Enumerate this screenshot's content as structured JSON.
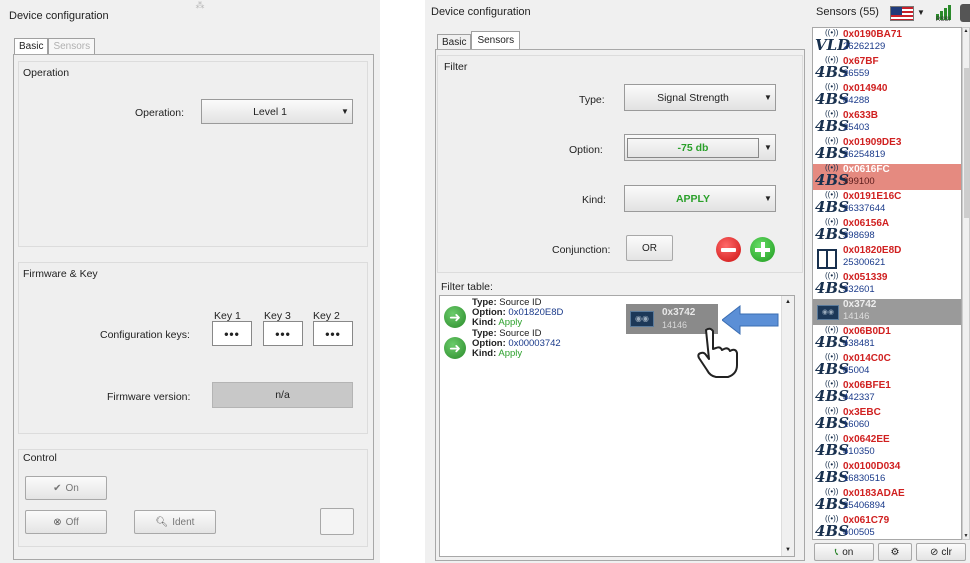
{
  "left": {
    "title": "Device configuration",
    "tabs": [
      "Basic",
      "Sensors"
    ],
    "operation_group": "Operation",
    "operation_label": "Operation:",
    "operation_value": "Level 1",
    "firmware_group": "Firmware & Key",
    "keys": [
      {
        "name": "Key 1",
        "value": "•••"
      },
      {
        "name": "Key 3",
        "value": "•••"
      },
      {
        "name": "Key 2",
        "value": "•••"
      }
    ],
    "config_keys_label": "Configuration keys:",
    "firmware_label": "Firmware version:",
    "firmware_value": "n/a",
    "control_group": "Control",
    "on_label": "On",
    "off_label": "Off",
    "ident_label": "Ident"
  },
  "right": {
    "title": "Device configuration",
    "tabs": [
      "Basic",
      "Sensors"
    ],
    "filter_group": "Filter",
    "type_label": "Type:",
    "type_value": "Signal Strength",
    "option_label": "Option:",
    "option_value": "-75 db",
    "kind_label": "Kind:",
    "kind_value": "APPLY",
    "conj_label": "Conjunction:",
    "conj_value": "OR",
    "filter_table_label": "Filter table:",
    "filter_rows": [
      {
        "type_key": "Type:",
        "type_val": "Source ID",
        "opt_key": "Option:",
        "opt_val": "0x01820E8D",
        "kind_key": "Kind:",
        "kind_val": "Apply"
      },
      {
        "type_key": "Type:",
        "type_val": "Source ID",
        "opt_key": "Option:",
        "opt_val": "0x00003742",
        "kind_key": "Kind:",
        "kind_val": "Apply"
      }
    ],
    "drag_hex": "0x3742",
    "drag_dec": "14146"
  },
  "sensors": {
    "title": "Sensors (55)",
    "rssi_label": "RSSI",
    "items": [
      {
        "icon": "VLD",
        "hex": "0x0190BA71",
        "dec": "26262129"
      },
      {
        "icon": "4BS",
        "hex": "0x67BF",
        "dec": "26559"
      },
      {
        "icon": "4BS",
        "hex": "0x014940",
        "dec": "84288"
      },
      {
        "icon": "4BS",
        "hex": "0x633B",
        "dec": "25403"
      },
      {
        "icon": "4BS",
        "hex": "0x01909DE3",
        "dec": "26254819"
      },
      {
        "icon": "4BS",
        "hex": "0x0616FC",
        "dec": "399100",
        "selected": true
      },
      {
        "icon": "4BS",
        "hex": "0x0191E16C",
        "dec": "26337644"
      },
      {
        "icon": "4BS",
        "hex": "0x06156A",
        "dec": "398698"
      },
      {
        "icon": "WIN",
        "hex": "0x01820E8D",
        "dec": "25300621"
      },
      {
        "icon": "4BS",
        "hex": "0x051339",
        "dec": "332601"
      },
      {
        "icon": "DEV",
        "hex": "0x3742",
        "dec": "14146",
        "ghost": true
      },
      {
        "icon": "4BS",
        "hex": "0x06B0D1",
        "dec": "438481"
      },
      {
        "icon": "4BS",
        "hex": "0x014C0C",
        "dec": "85004"
      },
      {
        "icon": "4BS",
        "hex": "0x06BFE1",
        "dec": "442337"
      },
      {
        "icon": "4BS",
        "hex": "0x3EBC",
        "dec": "16060"
      },
      {
        "icon": "4BS",
        "hex": "0x0642EE",
        "dec": "410350"
      },
      {
        "icon": "4BS",
        "hex": "0x0100D034",
        "dec": "16830516"
      },
      {
        "icon": "4BS",
        "hex": "0x0183ADAE",
        "dec": "25406894"
      },
      {
        "icon": "4BS",
        "hex": "0x061C79",
        "dec": "400505"
      }
    ],
    "on_label": "on",
    "clear_label": "clr"
  },
  "colors": {
    "accent_red": "#d02020",
    "green": "#2aa02a",
    "selected": "#e58a80",
    "blue_text": "#1a3a8a"
  }
}
